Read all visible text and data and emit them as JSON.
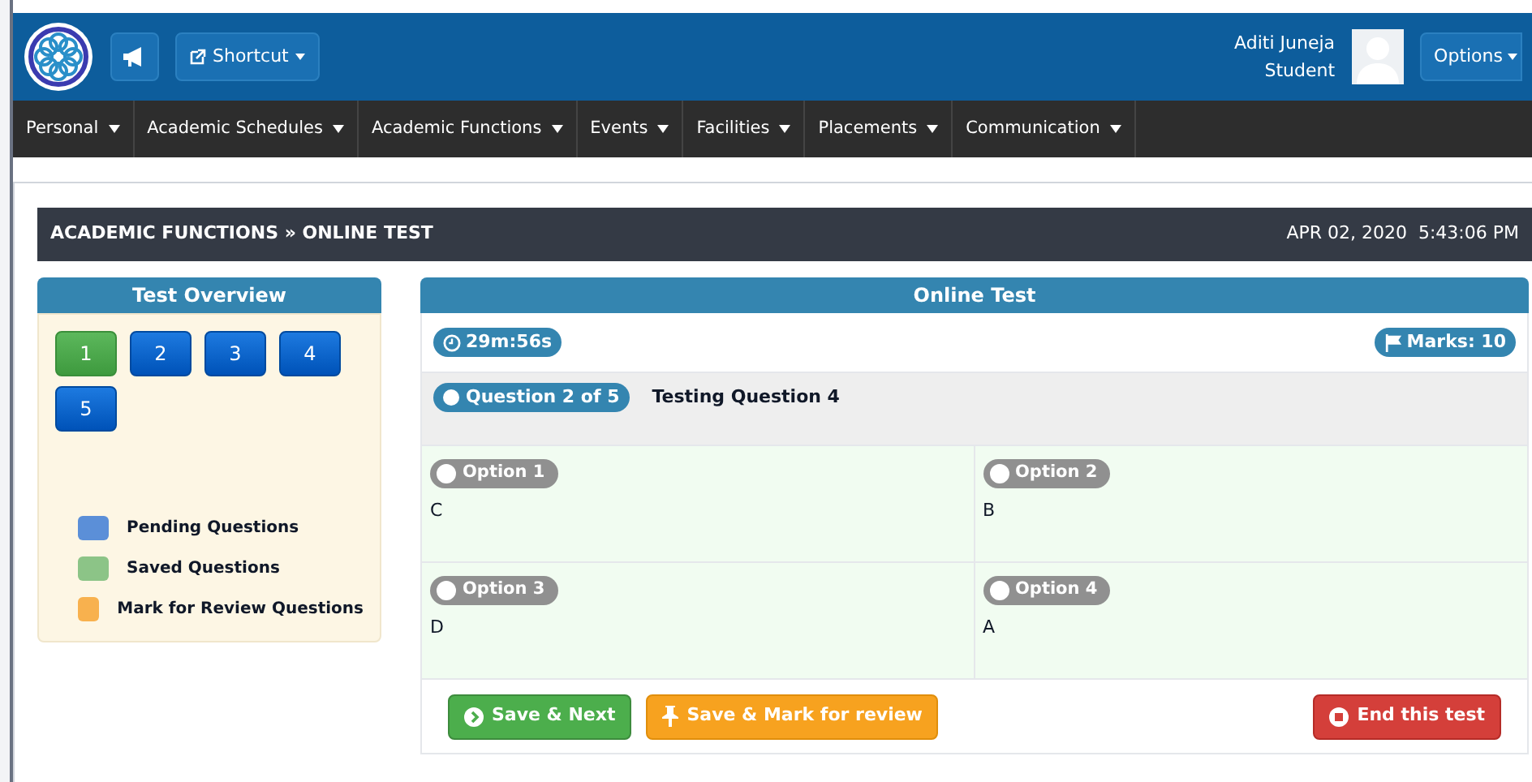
{
  "header": {
    "shortcut": "Shortcut",
    "user": {
      "name": "Aditi Juneja",
      "role": "Student"
    },
    "options": "Options"
  },
  "nav": [
    "Personal",
    "Academic Schedules",
    "Academic Functions",
    "Events",
    "Facilities",
    "Placements",
    "Communication"
  ],
  "breadcrumb": {
    "path": "ACADEMIC FUNCTIONS » ONLINE TEST",
    "datetime": "APR 02, 2020  5:43:06 PM"
  },
  "overview": {
    "title": "Test Overview",
    "questions": [
      {
        "label": "1",
        "saved": true
      },
      {
        "label": "2",
        "saved": false
      },
      {
        "label": "3",
        "saved": false
      },
      {
        "label": "4",
        "saved": false
      },
      {
        "label": "5",
        "saved": false
      }
    ],
    "legend": [
      {
        "label": "Pending Questions",
        "color": "#5b8fd8"
      },
      {
        "label": "Saved Questions",
        "color": "#8cc487"
      },
      {
        "label": "Mark for Review Questions",
        "color": "#f8b14e"
      }
    ]
  },
  "test": {
    "title": "Online Test",
    "timer": "29m:56s",
    "marks": "Marks: 10",
    "question_badge": "Question 2 of 5",
    "question": "Testing Question 4",
    "options": [
      {
        "label": "Option 1",
        "answer": "C",
        "checked": false
      },
      {
        "label": "Option 2",
        "answer": "B",
        "checked": false
      },
      {
        "label": "Option 3",
        "answer": "D",
        "checked": false
      },
      {
        "label": "Option 4",
        "answer": "A",
        "checked": false
      }
    ],
    "buttons": [
      {
        "label": "Save & Next",
        "kind": "next"
      },
      {
        "label": "Save & Mark for review",
        "kind": "review"
      },
      {
        "label": "End this test",
        "kind": "end"
      }
    ]
  }
}
